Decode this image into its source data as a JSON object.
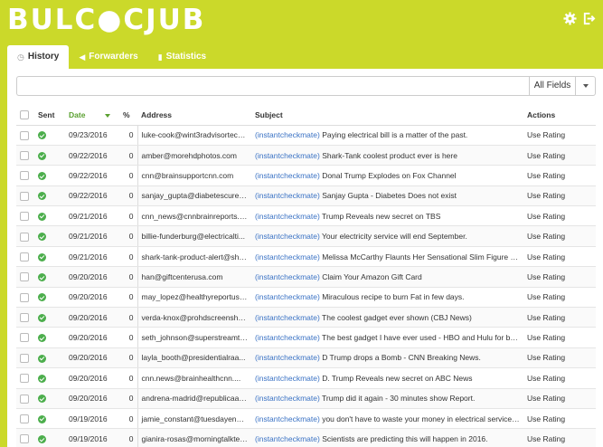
{
  "app": {
    "logo": "BULC●CJUB",
    "settings_icon": "gear-icon",
    "logout_icon": "logout-icon"
  },
  "tabs": [
    {
      "label": "History",
      "icon": "clock-icon",
      "active": true
    },
    {
      "label": "Forwarders",
      "icon": "send-icon",
      "active": false
    },
    {
      "label": "Statistics",
      "icon": "bar-chart-icon",
      "active": false
    }
  ],
  "filter": {
    "search_value": "",
    "field_selected": "All Fields"
  },
  "table": {
    "headers": {
      "sent": "Sent",
      "date": "Date",
      "pct": "%",
      "address": "Address",
      "subject": "Subject",
      "actions": "Actions"
    },
    "rows": [
      {
        "date": "09/23/2016",
        "pct": "0",
        "address": "luke-cook@wint3radvisortech...",
        "tag": "(instantcheckmate)",
        "subject": "Paying electrical bill is a matter of the past.",
        "action": "Use Rating"
      },
      {
        "date": "09/22/2016",
        "pct": "0",
        "address": "amber@morehdphotos.com",
        "tag": "(instantcheckmate)",
        "subject": "Shark-Tank coolest product ever is here",
        "action": "Use Rating"
      },
      {
        "date": "09/22/2016",
        "pct": "0",
        "address": "cnn@brainsupportcnn.com",
        "tag": "(instantcheckmate)",
        "subject": "Donal Trump Explodes on Fox Channel",
        "action": "Use Rating"
      },
      {
        "date": "09/22/2016",
        "pct": "0",
        "address": "sanjay_gupta@diabetescureo...",
        "tag": "(instantcheckmate)",
        "subject": "Sanjay Gupta - Diabetes Does not exist",
        "action": "Use Rating"
      },
      {
        "date": "09/21/2016",
        "pct": "0",
        "address": "cnn_news@cnnbrainreports.c...",
        "tag": "(instantcheckmate)",
        "subject": "Trump Reveals new secret on TBS",
        "action": "Use Rating"
      },
      {
        "date": "09/21/2016",
        "pct": "0",
        "address": "billie-funderburg@electricalti...",
        "tag": "(instantcheckmate)",
        "subject": "Your electricity service will end September.",
        "action": "Use Rating"
      },
      {
        "date": "09/21/2016",
        "pct": "0",
        "address": "shark-tank-product-alert@sha...",
        "tag": "(instantcheckmate)",
        "subject": "Melissa McCarthy Flaunts Her Sensational Slim Figure On...",
        "action": "Use Rating"
      },
      {
        "date": "09/20/2016",
        "pct": "0",
        "address": "han@giftcenterusa.com",
        "tag": "(instantcheckmate)",
        "subject": "Claim Your Amazon Gift Card",
        "action": "Use Rating"
      },
      {
        "date": "09/20/2016",
        "pct": "0",
        "address": "may_lopez@healthyreportusa...",
        "tag": "(instantcheckmate)",
        "subject": "Miraculous recipe to burn Fat in few days.",
        "action": "Use Rating"
      },
      {
        "date": "09/20/2016",
        "pct": "0",
        "address": "verda-knox@prohdscreensho...",
        "tag": "(instantcheckmate)",
        "subject": "The coolest gadget ever shown (CBJ News)",
        "action": "Use Rating"
      },
      {
        "date": "09/20/2016",
        "pct": "0",
        "address": "seth_johnson@superstreamtv...",
        "tag": "(instantcheckmate)",
        "subject": "The best gadget I have ever used - HBO and Hulu for basi...",
        "action": "Use Rating"
      },
      {
        "date": "09/20/2016",
        "pct": "0",
        "address": "layla_booth@presidentialraa...",
        "tag": "(instantcheckmate)",
        "subject": "D Trump drops a Bomb - CNN Breaking News.",
        "action": "Use Rating"
      },
      {
        "date": "09/20/2016",
        "pct": "0",
        "address": "cnn.news@brainhealthcnn....",
        "tag": "(instantcheckmate)",
        "subject": "D. Trump Reveals new secret on ABC News",
        "action": "Use Rating"
      },
      {
        "date": "09/20/2016",
        "pct": "0",
        "address": "andrena-madrid@republicaan...",
        "tag": "(instantcheckmate)",
        "subject": "Trump did it again - 30 minutes show Report.",
        "action": "Use Rating"
      },
      {
        "date": "09/19/2016",
        "pct": "0",
        "address": "jamie_constant@tuesdayener...",
        "tag": "(instantcheckmate)",
        "subject": "you don't have to waste your money in electrical service ...",
        "action": "Use Rating"
      },
      {
        "date": "09/19/2016",
        "pct": "0",
        "address": "gianira-rosas@morningtalktec...",
        "tag": "(instantcheckmate)",
        "subject": "Scientists are predicting this will happen in 2016.",
        "action": "Use Rating"
      }
    ]
  },
  "colors": {
    "background": "#cbd92a",
    "sent_ok": "#4cae4c",
    "sort_active": "#5aa030",
    "link": "#3a72c4"
  }
}
